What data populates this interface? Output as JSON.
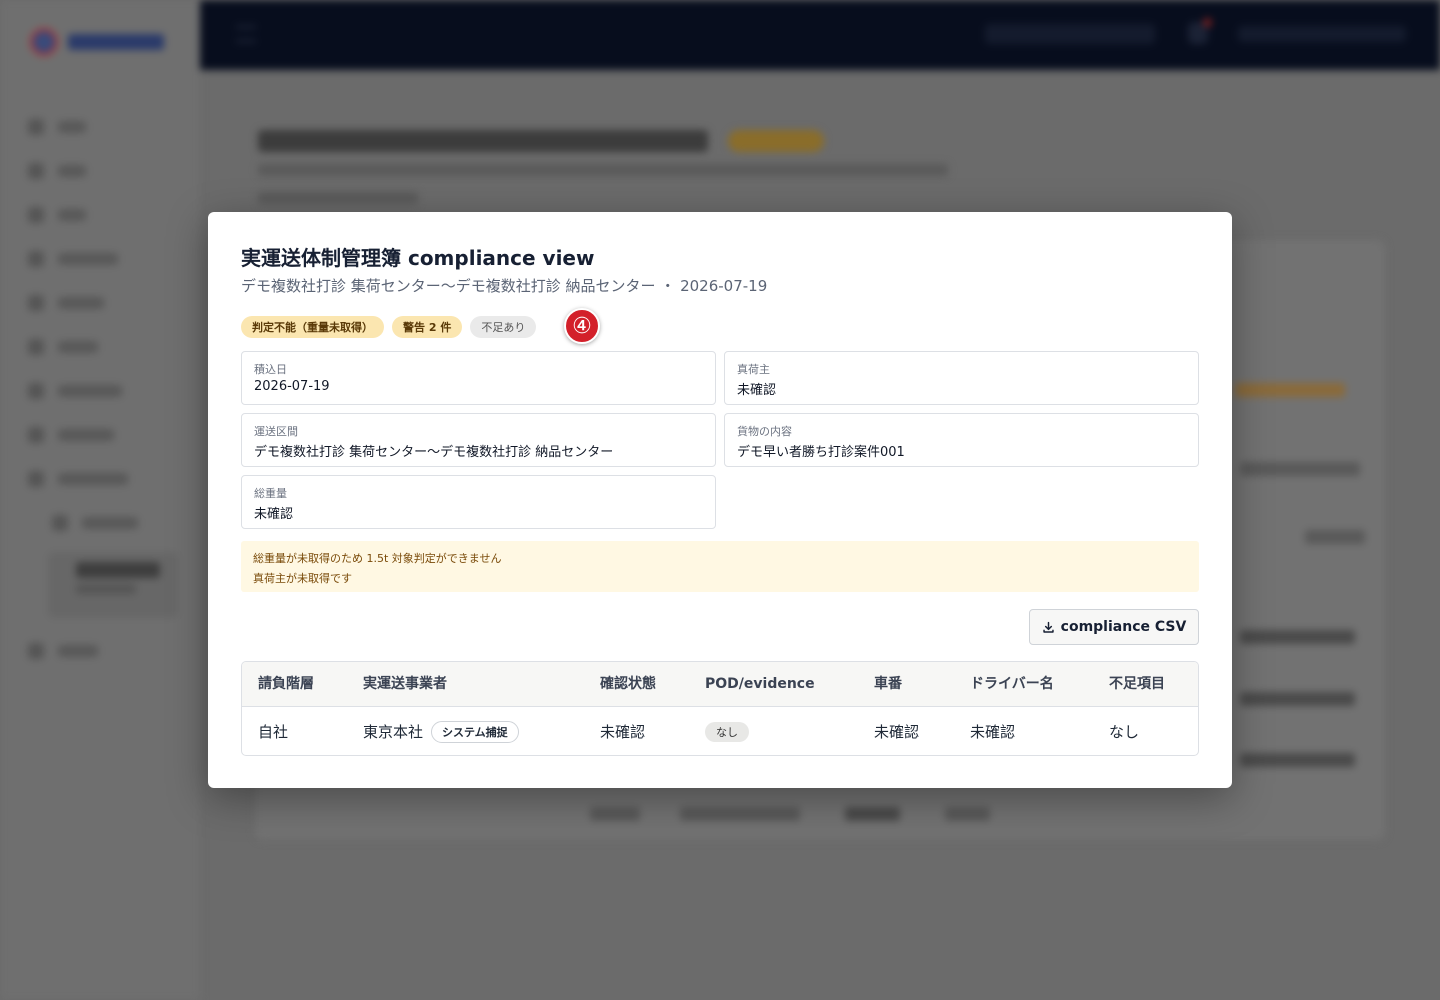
{
  "modal": {
    "title": "実運送体制管理簿 compliance view",
    "subtitle": "デモ複数社打診 集荷センター～デモ複数社打診 納品センター ・ 2026-07-19",
    "badges": {
      "undetermined": "判定不能（重量未取得）",
      "warnings": "警告 2 件",
      "missing": "不足あり"
    },
    "step_marker": "④",
    "fields": {
      "load_date": {
        "label": "積込日",
        "value": "2026-07-19"
      },
      "true_shipper": {
        "label": "真荷主",
        "value": "未確認"
      },
      "route": {
        "label": "運送区間",
        "value": "デモ複数社打診 集荷センター～デモ複数社打診 納品センター"
      },
      "cargo": {
        "label": "貨物の内容",
        "value": "デモ早い者勝ち打診案件001"
      },
      "total_weight": {
        "label": "総重量",
        "value": "未確認"
      }
    },
    "warnings": [
      "総重量が未取得のため 1.5t 対象判定ができません",
      "真荷主が未取得です"
    ],
    "csv_button": "compliance CSV",
    "table": {
      "headers": [
        "請負階層",
        "実運送事業者",
        "確認状態",
        "POD/evidence",
        "車番",
        "ドライバー名",
        "不足項目"
      ],
      "rows": [
        {
          "tier": "自社",
          "carrier": "東京本社",
          "carrier_tag": "システム捕捉",
          "status": "未確認",
          "pod": "なし",
          "plate": "未確認",
          "driver": "未確認",
          "missing": "なし"
        }
      ]
    }
  },
  "icons": {
    "csv": "download-icon"
  }
}
